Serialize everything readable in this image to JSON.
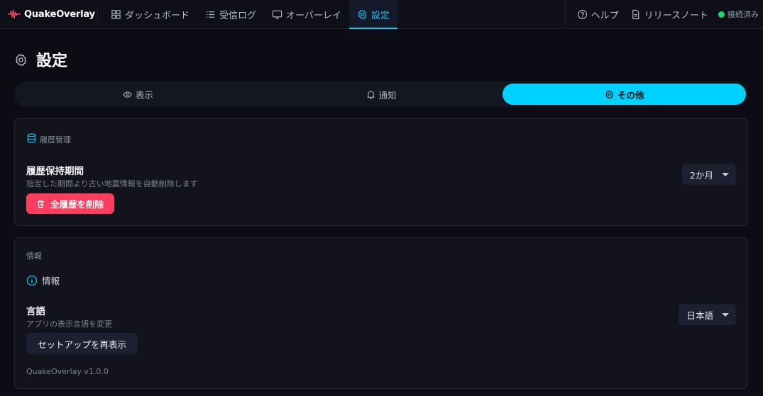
{
  "app": {
    "name": "QuakeOverlay"
  },
  "nav": {
    "items": [
      {
        "label": "ダッシュボード",
        "icon": "dashboard-icon"
      },
      {
        "label": "受信ログ",
        "icon": "list-icon"
      },
      {
        "label": "オーバーレイ",
        "icon": "monitor-icon"
      },
      {
        "label": "設定",
        "icon": "gear-icon",
        "active": true
      }
    ],
    "help_label": "ヘルプ",
    "release_notes_label": "リリースノート",
    "status_label": "接続済み"
  },
  "page": {
    "title": "設定"
  },
  "tabs": [
    {
      "label": "表示",
      "icon": "eye-icon"
    },
    {
      "label": "通知",
      "icon": "bell-icon"
    },
    {
      "label": "その他",
      "icon": "gear-icon",
      "active": true
    }
  ],
  "history": {
    "section_label": "履歴管理",
    "retention_label": "履歴保持期間",
    "retention_desc": "指定した期間より古い地震情報を自動削除します",
    "retention_value": "2か月",
    "delete_all_label": "全履歴を削除"
  },
  "info": {
    "section_label": "情報",
    "heading": "情報",
    "language_label": "言語",
    "language_desc": "アプリの表示言語を変更",
    "language_value": "日本語",
    "setup_button_label": "セットアップを再表示",
    "version": "QuakeOverlay v1.0.0"
  },
  "colors": {
    "accent": "#00d2ff",
    "danger": "#ff3d5e",
    "status_ok": "#1fdc6a",
    "background": "#0b0c14"
  }
}
